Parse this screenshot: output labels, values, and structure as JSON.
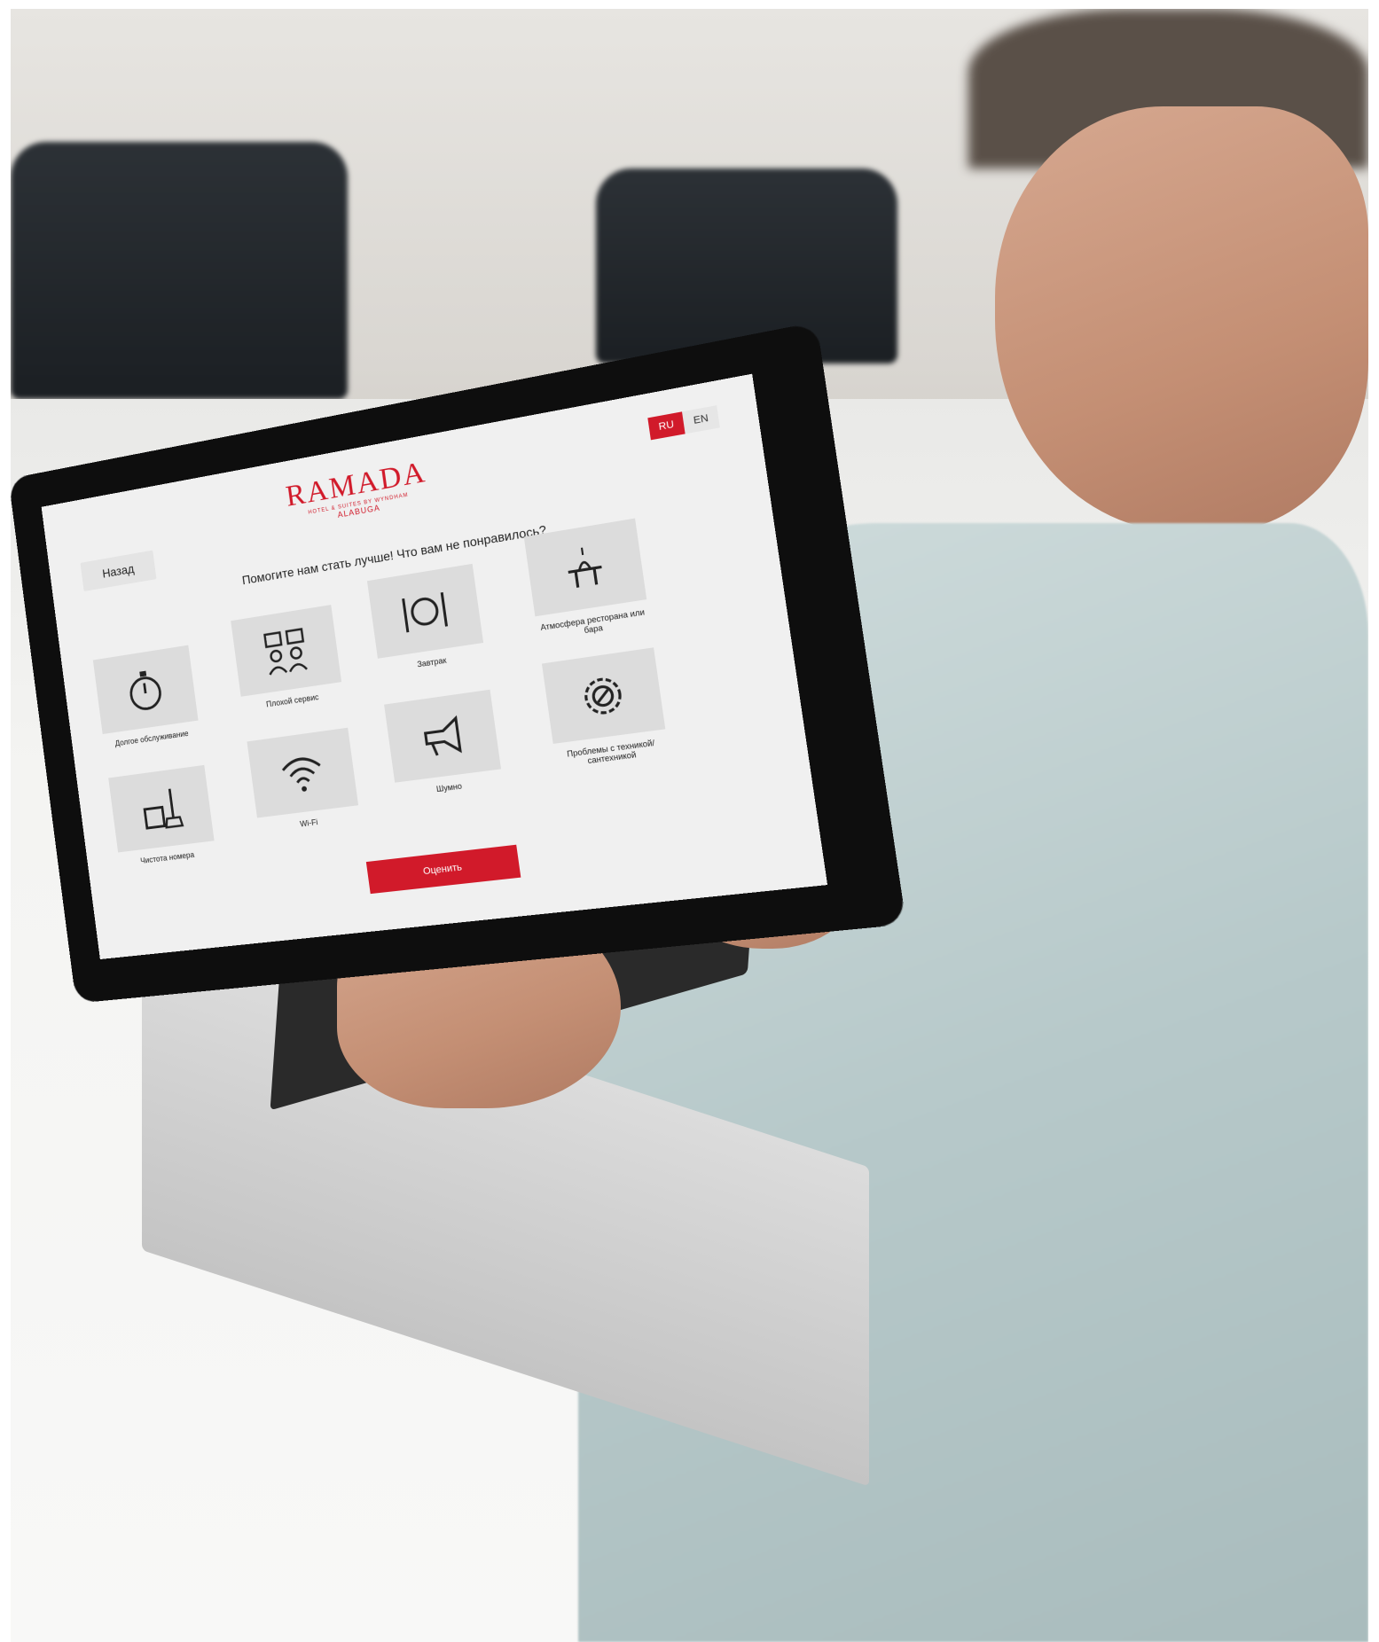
{
  "header": {
    "brand": "RAMADA",
    "subbrand": "HOTEL & SUITES BY WYNDHAM",
    "location": "ALABUGA"
  },
  "language": {
    "active": "RU",
    "options": [
      "RU",
      "EN"
    ]
  },
  "nav": {
    "back_label": "Назад"
  },
  "question": "Помогите нам стать лучше! Что вам не понравилось?",
  "options": [
    {
      "label": "Долгое обслуживание",
      "icon": "stopwatch-icon"
    },
    {
      "label": "Плохой сервис",
      "icon": "service-people-icon"
    },
    {
      "label": "Завтрак",
      "icon": "plate-cutlery-icon"
    },
    {
      "label": "Атмосфера ресторана или бара",
      "icon": "restaurant-table-icon"
    },
    {
      "label": "Чистота номера",
      "icon": "cleaning-bucket-icon"
    },
    {
      "label": "Wi-Fi",
      "icon": "wifi-icon"
    },
    {
      "label": "Шумно",
      "icon": "megaphone-icon"
    },
    {
      "label": "Проблемы с техникой/ сантехникой",
      "icon": "gear-wrench-icon"
    }
  ],
  "submit_label": "Оценить",
  "colors": {
    "accent": "#d11a2a",
    "tile": "#dcdcdc",
    "background": "#f0f0f0"
  }
}
